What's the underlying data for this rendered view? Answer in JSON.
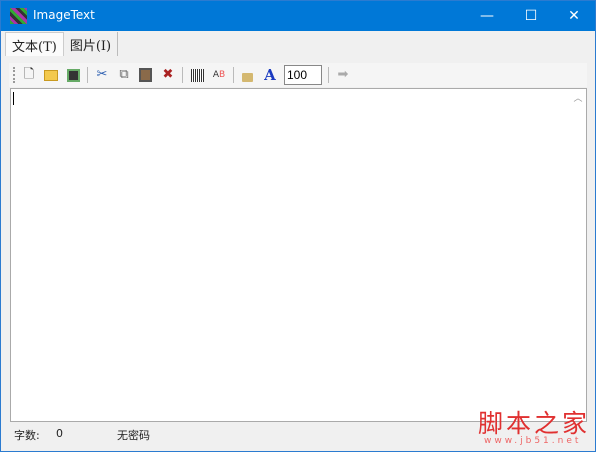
{
  "window": {
    "title": "ImageText",
    "minimize": "—",
    "maximize": "☐",
    "close": "✕"
  },
  "tabs": [
    {
      "label": "文本(T)"
    },
    {
      "label": "图片(I)"
    }
  ],
  "toolbar": {
    "zoom_value": "100",
    "icons": [
      "new-file",
      "open-folder",
      "save",
      "cut",
      "copy",
      "paste",
      "delete",
      "grid",
      "replace-text",
      "lock",
      "font",
      "go"
    ]
  },
  "editor": {
    "text": ""
  },
  "status": {
    "count_label": "字数:",
    "count_value": "0",
    "password_status": "无密码"
  },
  "watermark": {
    "title": "脚本之家",
    "url": "www.jb51.net"
  }
}
